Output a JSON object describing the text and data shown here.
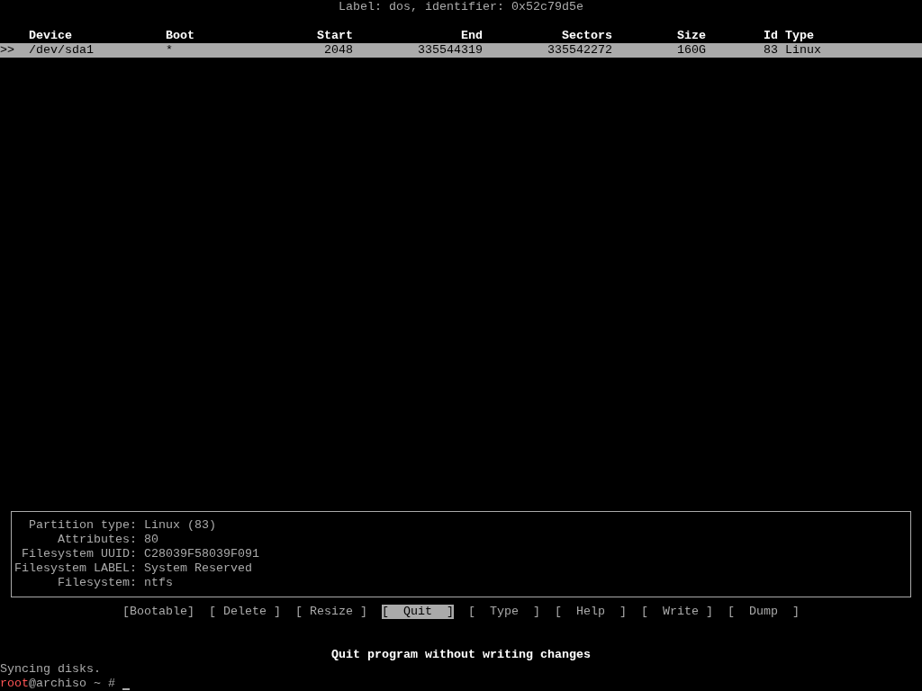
{
  "disk_label": "Label: dos, identifier: 0x52c79d5e",
  "table": {
    "columns": [
      "Device",
      "Boot",
      "Start",
      "End",
      "Sectors",
      "Size",
      "Id",
      "Type"
    ],
    "rows": [
      {
        "pointer": ">>",
        "selected": true,
        "cells": [
          "/dev/sda1",
          "*",
          "2048",
          "335544319",
          "335542272",
          "160G",
          "83",
          "Linux"
        ]
      }
    ]
  },
  "partition_info": [
    {
      "label": "Partition type:",
      "value": "Linux (83)"
    },
    {
      "label": "Attributes:",
      "value": "80"
    },
    {
      "label": "Filesystem UUID:",
      "value": "C28039F58039F091"
    },
    {
      "label": "Filesystem LABEL:",
      "value": "System Reserved"
    },
    {
      "label": "Filesystem:",
      "value": "ntfs"
    }
  ],
  "menu": [
    {
      "label": "[Bootable]",
      "selected": false
    },
    {
      "label": "[ Delete ]",
      "selected": false
    },
    {
      "label": "[ Resize ]",
      "selected": false
    },
    {
      "label": "[  Quit  ]",
      "selected": true
    },
    {
      "label": "[  Type  ]",
      "selected": false
    },
    {
      "label": "[  Help  ]",
      "selected": false
    },
    {
      "label": "[  Write ]",
      "selected": false
    },
    {
      "label": "[  Dump  ]",
      "selected": false
    }
  ],
  "help_text": "Quit program without writing changes",
  "shell": {
    "output": "Syncing disks.",
    "user": "root",
    "prompt": "@archiso ~ #"
  }
}
